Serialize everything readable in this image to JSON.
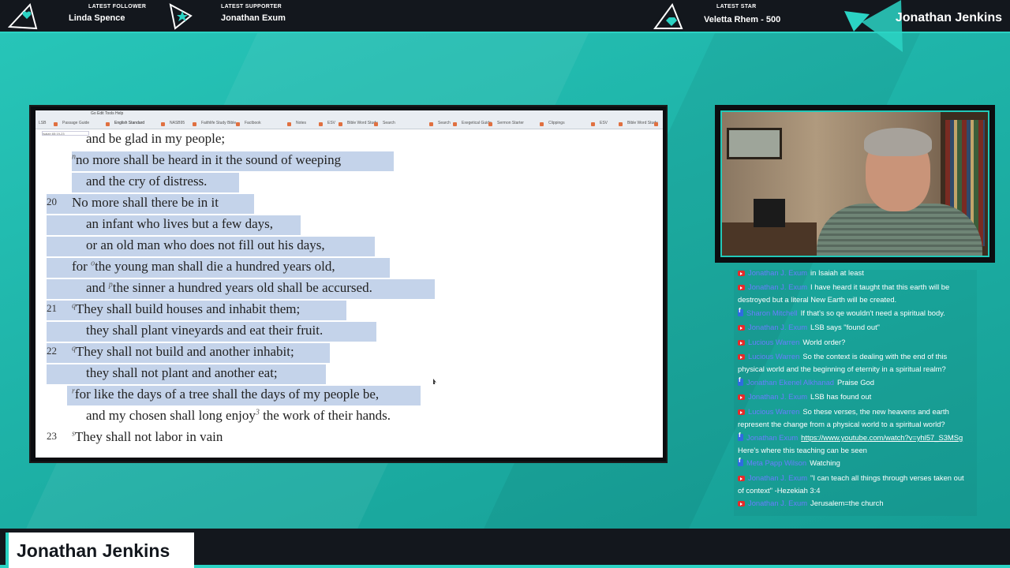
{
  "overlay": {
    "alerts": [
      {
        "label": "LATEST FOLLOWER",
        "value": "Linda Spence"
      },
      {
        "label": "LATEST SUPPORTER",
        "value": "Jonathan Exum"
      },
      {
        "label": "LATEST STAR",
        "value": "Veletta Rhem - 500"
      }
    ],
    "brand_name": "Jonathan Jenkins",
    "lower_third_name": "Jonathan Jenkins",
    "accent_color": "#2bd3c4",
    "bar_color": "#13171d"
  },
  "app": {
    "menu": "Go   Edit   Tools   Help",
    "reference": "Isaiah 65:19-23",
    "tabs": [
      "LSB",
      "Passage Guide",
      "English Standard",
      "NASB95",
      "Faithlife Study Bible",
      "Factbook",
      "Notes",
      "ESV",
      "Bible Word Study",
      "Search",
      "Search",
      "Exegetical Guide",
      "Sermon Starter",
      "Clippings",
      "ESV",
      "Bible Word Study"
    ],
    "lines": [
      {
        "text": "and be glad in my people;"
      },
      {
        "sup": "n",
        "text": "no more shall be heard in it the sound of weeping"
      },
      {
        "text": "and the cry of distress."
      },
      {
        "num": "20",
        "text": "No more shall there be in it"
      },
      {
        "text": "an infant who lives but a few days,"
      },
      {
        "text": "or an old man who does not fill out his days,"
      },
      {
        "pre": "for ",
        "sup": "o",
        "text": "the young man shall die a hundred years old,"
      },
      {
        "pre": "and ",
        "sup": "p",
        "text": "the sinner a hundred years old shall be accursed."
      },
      {
        "num": "21",
        "sup": "q",
        "text": "They shall build houses and inhabit them;"
      },
      {
        "text": "they shall plant vineyards and eat their fruit."
      },
      {
        "num": "22",
        "sup": "q",
        "text": "They shall not build and another inhabit;"
      },
      {
        "text": "they shall not plant and another eat;"
      },
      {
        "sup": "r",
        "text": "for like the days of a tree shall the days of my people be,"
      },
      {
        "pre": "and my chosen shall long enjoy",
        "sup": "3",
        "text": " the work of their hands."
      },
      {
        "num": "23",
        "sup": "s",
        "text": "They shall not labor in vain"
      }
    ]
  },
  "chat": {
    "messages": [
      {
        "platform": "youtube",
        "author": "Jonathan J. Exum",
        "text": "in Isaiah at least"
      },
      {
        "platform": "youtube",
        "author": "Jonathan J. Exum",
        "text": "I have heard it taught that this earth will be destroyed but a literal New Earth will be created."
      },
      {
        "platform": "facebook",
        "author": "Sharon Mitchell",
        "text": "If that's so qe wouldn't need a spiritual body."
      },
      {
        "platform": "youtube",
        "author": "Jonathan J. Exum",
        "text": "LSB says \"found out\""
      },
      {
        "platform": "youtube",
        "author": "Lucious Warren",
        "text": "World order?"
      },
      {
        "platform": "youtube",
        "author": "Lucious Warren",
        "text": "So the context is dealing with the end of this physical world and the beginning of eternity in a spiritual realm?"
      },
      {
        "platform": "facebook",
        "author": "Jonathan Ekenel Alkhanad",
        "text": "Praise God"
      },
      {
        "platform": "youtube",
        "author": "Jonathan J. Exum",
        "text": "LSB has found out"
      },
      {
        "platform": "youtube",
        "author": "Lucious Warren",
        "text": "So these verses, the new heavens and earth represent the change from a physical world to a spiritual world?"
      },
      {
        "platform": "facebook",
        "author": "Jonathan Exum",
        "link": "https://www.youtube.com/watch?v=yhl57_S3MSg",
        "text": " Here's where this teaching can be seen"
      },
      {
        "platform": "facebook",
        "author": "Meta Papp Wilson",
        "text": "Watching"
      },
      {
        "platform": "youtube",
        "author": "Jonathan J. Exum",
        "text": "\"I can teach all things through verses taken out of context\" -Hezekiah 3:4"
      },
      {
        "platform": "youtube",
        "author": "Jonathan J. Exum",
        "text": "Jerusalem=the church"
      }
    ]
  }
}
